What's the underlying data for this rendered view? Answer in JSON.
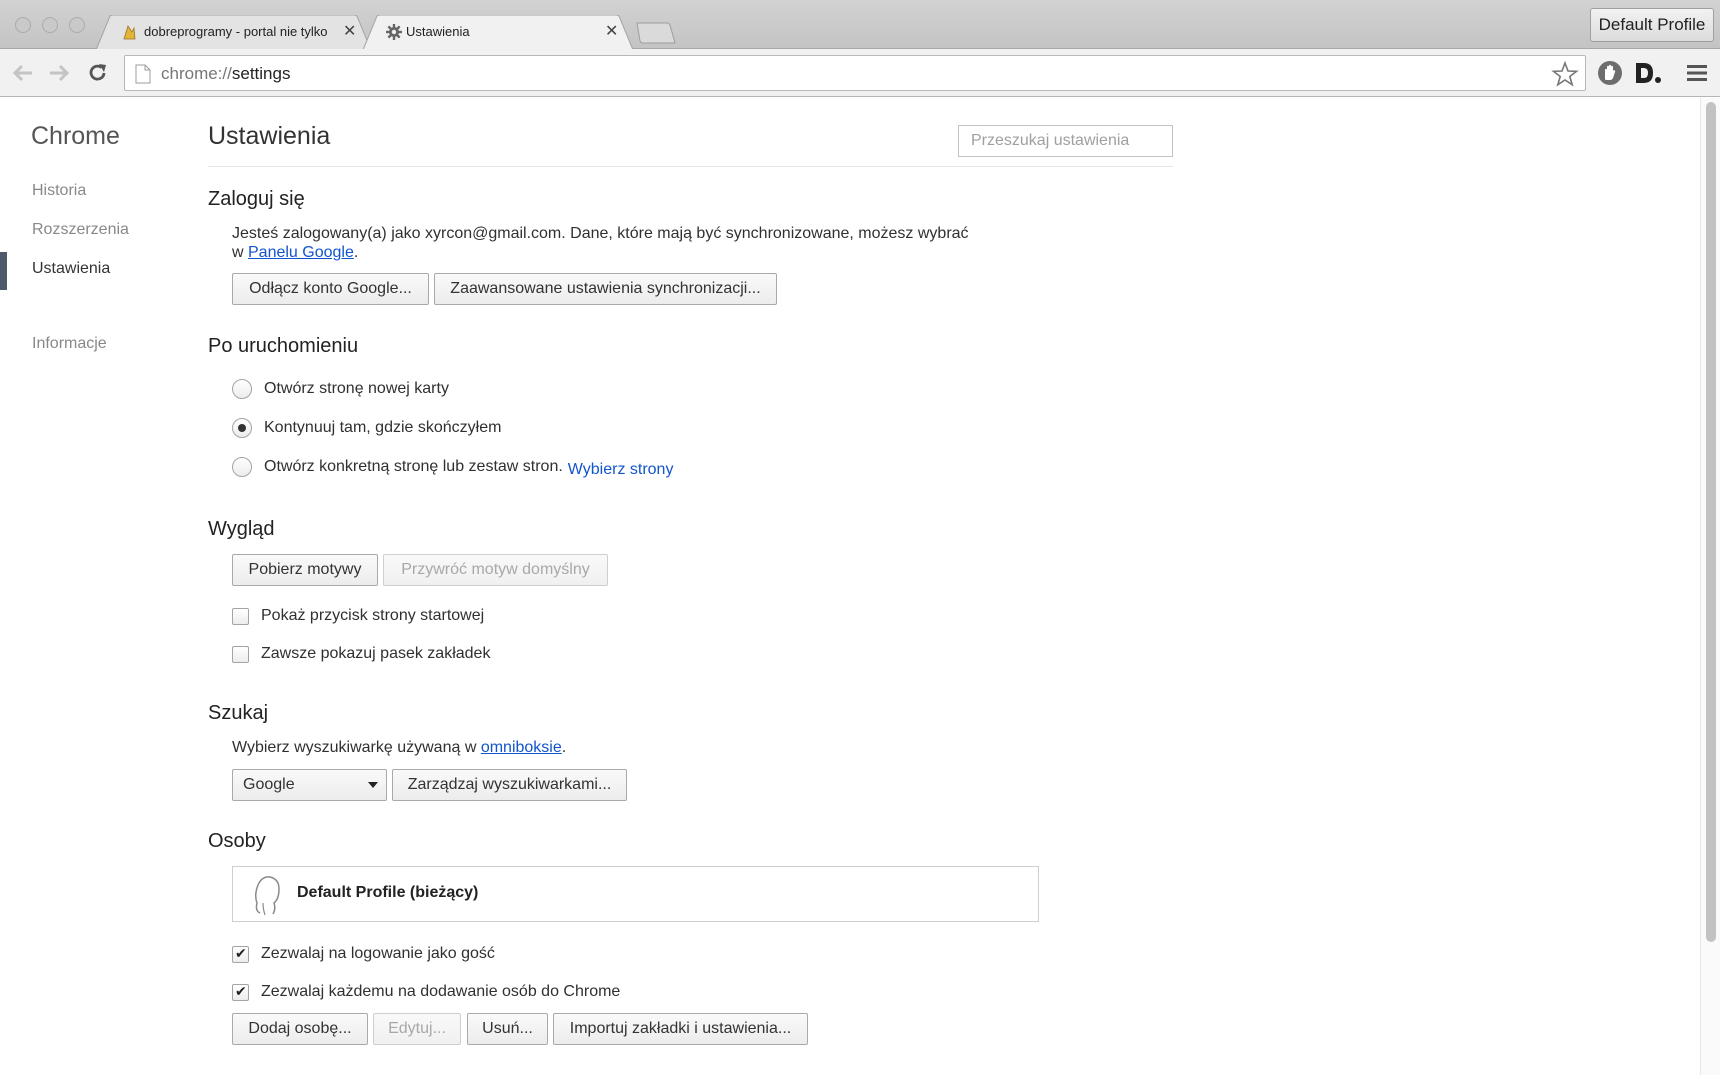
{
  "browser": {
    "tabs": [
      {
        "title": "dobreprogramy - portal nie tylko",
        "icon": "dobreprogramy-favicon",
        "active": false
      },
      {
        "title": "Ustawienia",
        "icon": "gear-icon",
        "active": true
      }
    ],
    "profile_button": "Default Profile",
    "url_prefix": "chrome://",
    "url_path": "settings"
  },
  "sidebar": {
    "title": "Chrome",
    "items": [
      {
        "label": "Historia"
      },
      {
        "label": "Rozszerzenia"
      },
      {
        "label": "Ustawienia",
        "active": true
      },
      {
        "label": "Informacje"
      }
    ]
  },
  "header": {
    "title": "Ustawienia",
    "search_placeholder": "Przeszukaj ustawienia"
  },
  "signin": {
    "title": "Zaloguj się",
    "text_before": "Jesteś zalogowany(a) jako xyrcon@gmail.com. Dane, które mają być synchronizowane, możesz wybrać",
    "text_w": "w ",
    "link": "Panelu Google",
    "text_after": ".",
    "disconnect_button": "Odłącz konto Google...",
    "advanced_sync_button": "Zaawansowane ustawienia synchronizacji..."
  },
  "startup": {
    "title": "Po uruchomieniu",
    "options": [
      {
        "label": "Otwórz stronę nowej karty",
        "checked": false
      },
      {
        "label": "Kontynuuj tam, gdzie skończyłem",
        "checked": true
      },
      {
        "label": "Otwórz konkretną stronę lub zestaw stron.",
        "checked": false
      }
    ],
    "choose_pages_link": "Wybierz strony"
  },
  "appearance": {
    "title": "Wygląd",
    "get_themes_button": "Pobierz motywy",
    "reset_theme_button": "Przywróć motyw domyślny",
    "show_home_button": {
      "label": "Pokaż przycisk strony startowej",
      "checked": false
    },
    "show_bookmarks_bar": {
      "label": "Zawsze pokazuj pasek zakładek",
      "checked": false
    }
  },
  "search": {
    "title": "Szukaj",
    "text_before": "Wybierz wyszukiwarkę używaną w ",
    "link": "omniboksie",
    "text_after": ".",
    "engine_selected": "Google",
    "manage_button": "Zarządzaj wyszukiwarkami..."
  },
  "people": {
    "title": "Osoby",
    "profile_name": "Default Profile (bieżący)",
    "guest_browsing": {
      "label": "Zezwalaj na logowanie jako gość",
      "checked": true
    },
    "add_persons": {
      "label": "Zezwalaj każdemu na dodawanie osób do Chrome",
      "checked": true
    },
    "add_button": "Dodaj osobę...",
    "edit_button": "Edytuj...",
    "remove_button": "Usuń...",
    "import_button": "Importuj zakładki i ustawienia..."
  }
}
